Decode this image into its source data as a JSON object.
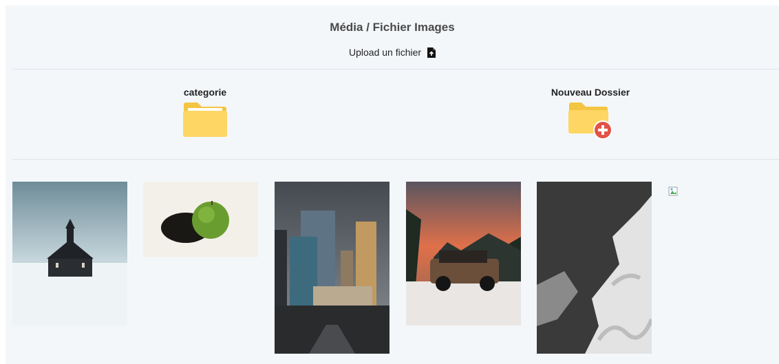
{
  "header": {
    "title": "Média / Fichier Images",
    "upload_label": "Upload un fichier",
    "upload_icon": "file-upload-icon"
  },
  "folders": [
    {
      "label": "categorie",
      "icon": "folder-icon",
      "color": "#fdd663"
    },
    {
      "label": "Nouveau Dossier",
      "icon": "folder-add-icon",
      "color": "#fdd663",
      "badge_color": "#e25247"
    }
  ],
  "images": [
    {
      "subject": "church in snow"
    },
    {
      "subject": "green apple"
    },
    {
      "subject": "city skyscrapers"
    },
    {
      "subject": "suv in snowy forest"
    },
    {
      "subject": "aerial black and white terrain"
    },
    {
      "subject": "broken image"
    }
  ],
  "colors": {
    "background": "#f4f7fa",
    "divider": "#dde3e8",
    "title": "#4a4a4a"
  }
}
